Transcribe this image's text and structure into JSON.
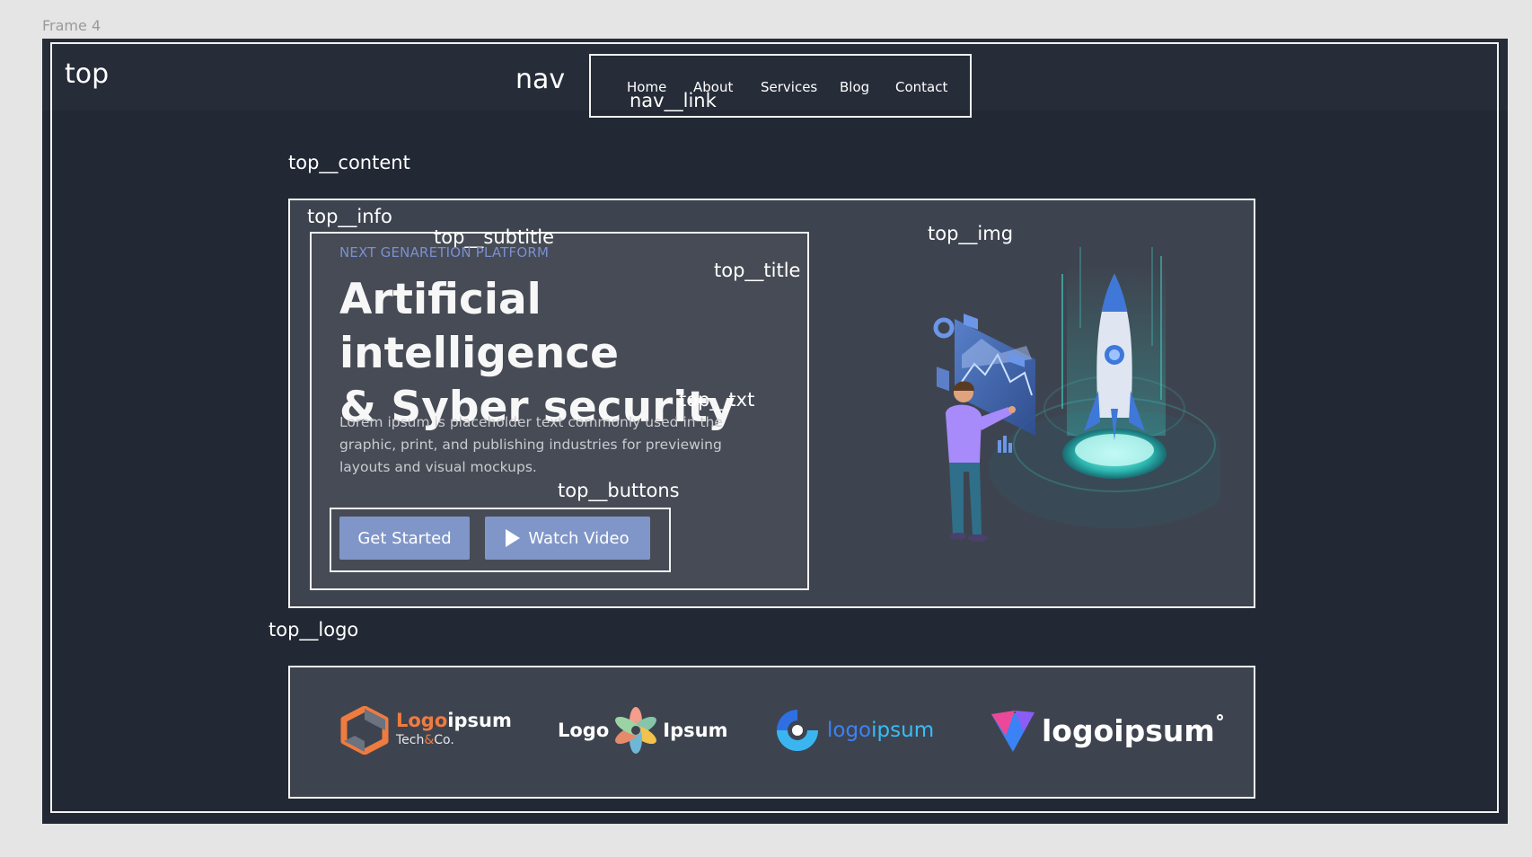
{
  "frame_label": "Frame 4",
  "annotations": {
    "top": "top",
    "nav": "nav",
    "nav_link": "nav__link",
    "top_content": "top__content",
    "top_info": "top__info",
    "top_subtitle": "top__subtitle",
    "top_title": "top__title",
    "top_txt": "top__txt",
    "top_buttons": "top__buttons",
    "top_img": "top__img",
    "top_logo": "top__logo"
  },
  "nav": {
    "links": [
      "Home",
      "About",
      "Services",
      "Blog",
      "Contact"
    ]
  },
  "hero": {
    "subtitle": "NEXT GENARETION PLATFORM",
    "title_line1": "Artificial intelligence",
    "title_line2": "& Syber security",
    "text": "Lorem ipsum is placeholder text commonly used in the graphic, print, and publishing industries for previewing layouts and visual mockups.",
    "primary_button": "Get Started",
    "secondary_button": "Watch Video"
  },
  "logos": {
    "logo1": {
      "part1": "Logo",
      "part2": "ipsum",
      "sub1": "Tech",
      "sub_amp": "&",
      "sub2": "Co."
    },
    "logo2": {
      "part1": "Logo",
      "part2": "Ipsum"
    },
    "logo3": {
      "part1": "logo",
      "part2": "ipsum"
    },
    "logo4": {
      "text": "logoipsum"
    }
  },
  "colors": {
    "frame_bg": "#222834",
    "panel_bg": "#3e444f",
    "subtitle": "#7b8fd0",
    "button": "#8096c9"
  }
}
